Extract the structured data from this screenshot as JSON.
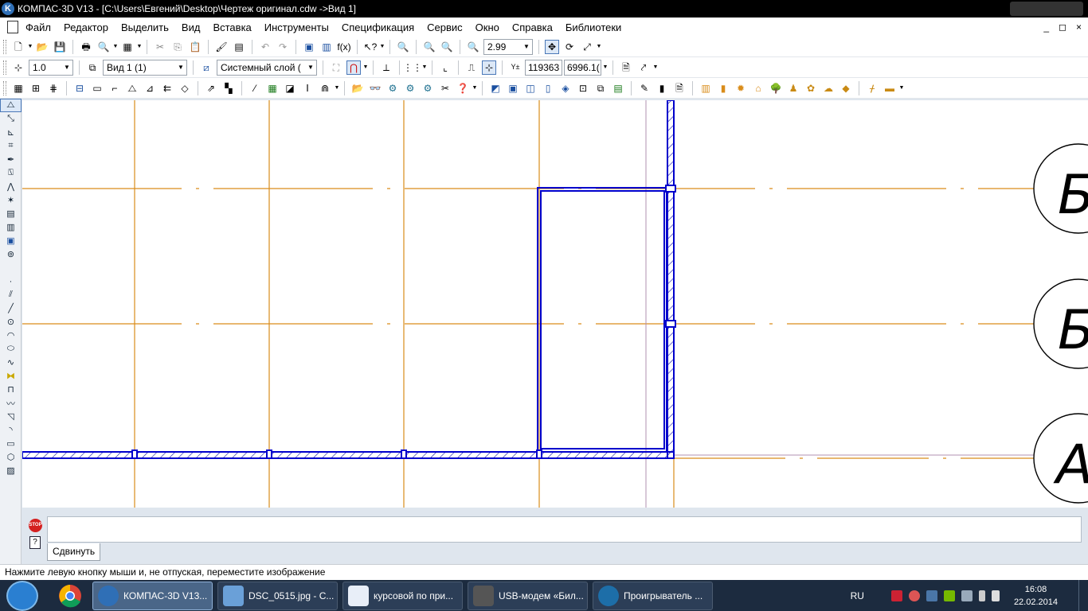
{
  "window": {
    "title": "КОМПАС-3D V13 - [C:\\Users\\Евгений\\Desktop\\Чертеж оригинал.cdw ->Вид 1]"
  },
  "menu": [
    "Файл",
    "Редактор",
    "Выделить",
    "Вид",
    "Вставка",
    "Инструменты",
    "Спецификация",
    "Сервис",
    "Окно",
    "Справка",
    "Библиотеки"
  ],
  "mdi_controls": [
    "_",
    "◻",
    "×"
  ],
  "toolbar_top": {
    "zoom_value": "2.99"
  },
  "toolbar_current": {
    "step_value": "1.0",
    "view_value": "Вид 1 (1)",
    "layer_value": "Системный слой (",
    "coord_x": "119363",
    "coord_y": "6996.1("
  },
  "drawing": {
    "axis_labels": [
      "Б",
      "Б",
      "А"
    ],
    "colors": {
      "axis": "#d98c1a",
      "wall": "#0000cc",
      "hatch": "#1010aa",
      "thin": "#b090b0"
    }
  },
  "command": {
    "active_tab": "Сдвинуть",
    "stop_label": "STOP"
  },
  "status": {
    "message": "Нажмите левую кнопку мыши и, не отпуская, переместите изображение"
  },
  "taskbar": {
    "items": [
      {
        "label": "КОМПАС-3D V13...",
        "active": true
      },
      {
        "label": "DSC_0515.jpg - С...",
        "active": false
      },
      {
        "label": "курсовой по при...",
        "active": false
      },
      {
        "label": "USB-модем «Бил...",
        "active": false
      },
      {
        "label": "Проигрыватель ...",
        "active": false
      }
    ],
    "lang": "RU",
    "time": "16:08",
    "date": "22.02.2014"
  }
}
